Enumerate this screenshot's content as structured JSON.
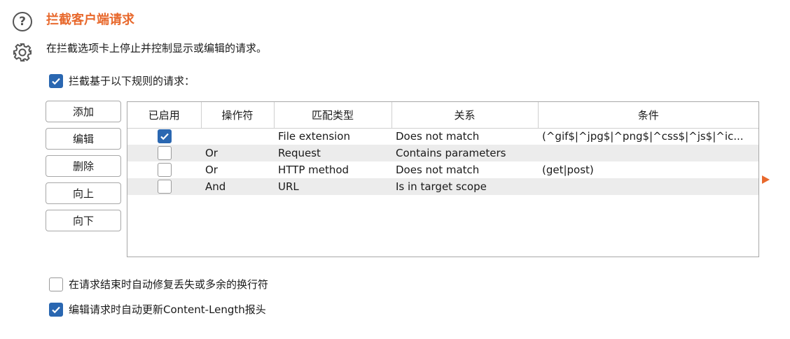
{
  "header": {
    "title": "拦截客户端请求",
    "description": "在拦截选项卡上停止并控制显示或编辑的请求。"
  },
  "intercept_rules": {
    "label": "拦截基于以下规则的请求：",
    "checked": true
  },
  "buttons": {
    "add": "添加",
    "edit": "编辑",
    "remove": "删除",
    "up": "向上",
    "down": "向下"
  },
  "table": {
    "columns": [
      "已启用",
      "操作符",
      "匹配类型",
      "关系",
      "条件"
    ],
    "rows": [
      {
        "enabled": true,
        "operator": "",
        "match_type": "File extension",
        "relationship": "Does not match",
        "condition": "(^gif$|^jpg$|^png$|^css$|^js$|^ic..."
      },
      {
        "enabled": false,
        "operator": "Or",
        "match_type": "Request",
        "relationship": "Contains parameters",
        "condition": ""
      },
      {
        "enabled": false,
        "operator": "Or",
        "match_type": "HTTP method",
        "relationship": "Does not match",
        "condition": "(get|post)"
      },
      {
        "enabled": false,
        "operator": "And",
        "match_type": "URL",
        "relationship": "Is in target scope",
        "condition": ""
      }
    ]
  },
  "options": {
    "fix_newlines": {
      "label": "在请求结束时自动修复丢失或多余的换行符",
      "checked": false
    },
    "update_content_length": {
      "label": "编辑请求时自动更新Content-Length报头",
      "checked": true
    }
  },
  "icons": {
    "help": "help-icon",
    "settings": "gear-icon",
    "expand": "expand-arrow-icon"
  },
  "colors": {
    "accent": "#e8692d",
    "checkbox": "#2a67b1"
  }
}
